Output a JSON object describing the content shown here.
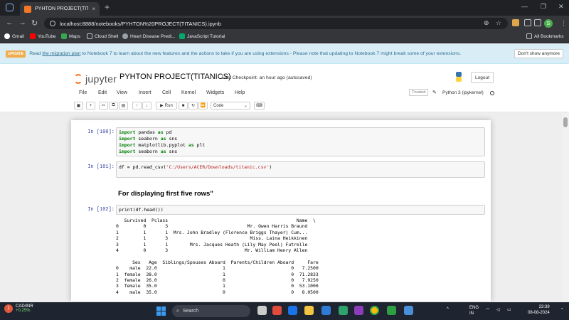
{
  "browser": {
    "tab_title": "PYHTON PROJECT(TITANICS) -",
    "tab_close": "×",
    "new_tab": "+",
    "url": "localhost:8888/notebooks/PYHTON%20PROJECT(TITANICS).ipynb",
    "profile_letter": "S",
    "bookmarks": [
      "Gmail",
      "YouTube",
      "Maps",
      "Cloud Shell",
      "Heart Disease Predi...",
      "JavaScript Tutorial"
    ],
    "all_bookmarks": "All Bookmarks"
  },
  "banner": {
    "badge": "UPDATE",
    "text_before": "Read ",
    "link": "the migration plan",
    "text_after": " to Notebook 7 to learn about the new features and the actions to take if you are using extensions - Please note that updating to Notebook 7 might break some of your extensions.",
    "button": "Don't show anymore"
  },
  "jupyter": {
    "logo_text": "jupyter",
    "notebook_title": "PYHTON PROJECT(TITANICS)",
    "checkpoint": "Last Checkpoint: an hour ago  (autosaved)",
    "logout": "Logout",
    "menu": [
      "File",
      "Edit",
      "View",
      "Insert",
      "Cell",
      "Kernel",
      "Widgets",
      "Help"
    ],
    "trusted": "Trusted",
    "kernel": "Python 3 (ipykernel)",
    "run_label": "Run",
    "cell_type": "Code"
  },
  "cells": {
    "c1": {
      "prompt": "In [100]:",
      "lines": [
        [
          "import",
          " pandas ",
          "as",
          " pd"
        ],
        [
          "import",
          " seaborn ",
          "as",
          " sns"
        ],
        [
          "import",
          " matplotlib.pyplot ",
          "as",
          " plt"
        ],
        [
          "import",
          " seaborn ",
          "as",
          " sns"
        ]
      ]
    },
    "c2": {
      "prompt": "In [101]:",
      "code_prefix": "df = pd.read_csv(",
      "code_string": "'C:/Users/ACER/Downloads/titanic.csv'",
      "code_suffix": ")"
    },
    "md_heading": "For displaying first five rows\"",
    "c3": {
      "prompt": "In [102]:",
      "code": "print(df.head())",
      "output": "   Survived  Pclass                                               Name  \\\n0         0       3                             Mr. Owen Harris Braund   \n1         1       1  Mrs. John Bradley (Florence Briggs Thayer) Cum...   \n2         1       3                              Miss. Laina Heikkinen   \n3         1       1        Mrs. Jacques Heath (Lily May Peel) Futrelle   \n4         0       3                            Mr. William Henry Allen   \n\n      Sex   Age  Siblings/Spouses Aboard  Parents/Children Aboard     Fare\n0    male  22.0                        1                        0   7.2500\n1  female  38.0                        1                        0  71.2833\n2  female  26.0                        0                        0   7.9250\n3  female  35.0                        1                        0  53.1000\n4    male  35.0                        0                        0   8.0500"
    }
  },
  "taskbar": {
    "ticker": "CAD/INR",
    "change": "+0.25%",
    "badge": "1",
    "search": "Search",
    "lang1": "ENG",
    "lang2": "IN",
    "time": "23:39",
    "date": "08-08-2024"
  },
  "colors": {
    "jupyter_orange": "#f37726",
    "banner_bg": "#d9edf7",
    "prompt_blue": "#303f9f"
  }
}
